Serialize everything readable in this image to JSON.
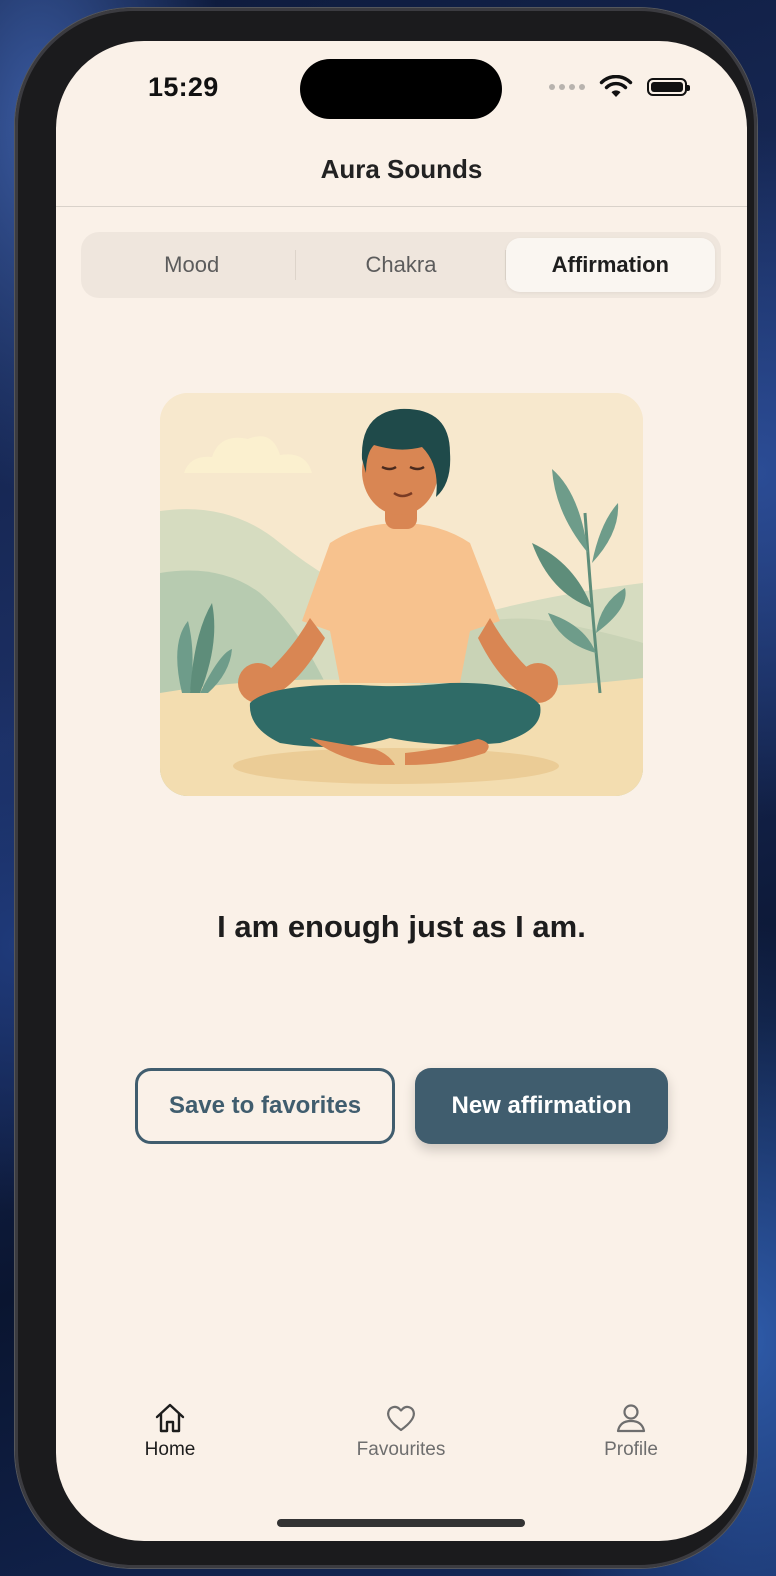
{
  "status": {
    "time": "15:29"
  },
  "header": {
    "title": "Aura Sounds"
  },
  "tabs": [
    {
      "label": "Mood",
      "active": false
    },
    {
      "label": "Chakra",
      "active": false
    },
    {
      "label": "Affirmation",
      "active": true
    }
  ],
  "main": {
    "illustration": "meditating-person-illustration",
    "affirmation": "I am enough just as I am.",
    "save_label": "Save to favorites",
    "new_label": "New affirmation"
  },
  "nav": {
    "items": [
      {
        "label": "Home",
        "icon": "home-icon",
        "active": true
      },
      {
        "label": "Favourites",
        "icon": "heart-icon",
        "active": false
      },
      {
        "label": "Profile",
        "icon": "person-icon",
        "active": false
      }
    ]
  },
  "colors": {
    "background": "#faf1e8",
    "accent": "#405d6e",
    "segmented_bg": "#efe6dd"
  }
}
